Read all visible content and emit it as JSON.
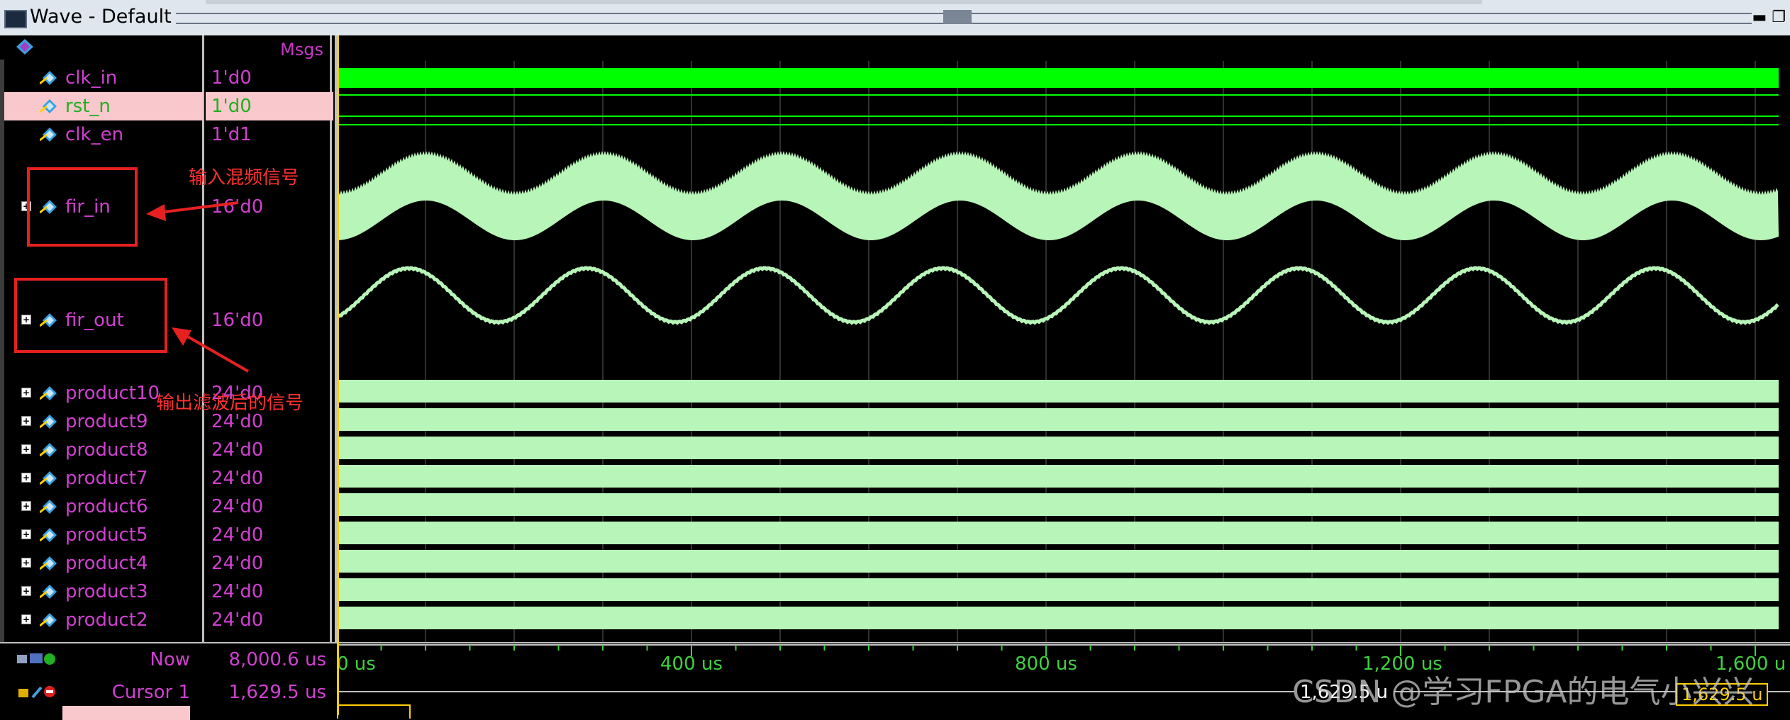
{
  "window": {
    "title": "Wave - Default"
  },
  "header": {
    "msgs_label": "Msgs"
  },
  "signals": [
    {
      "name": "clk_in",
      "value": "1'd0",
      "expandable": false,
      "selected": false
    },
    {
      "name": "rst_n",
      "value": "1'd0",
      "expandable": false,
      "selected": true
    },
    {
      "name": "clk_en",
      "value": "1'd1",
      "expandable": false,
      "selected": false
    },
    {
      "name": "fir_in",
      "value": "16'd0",
      "expandable": true,
      "selected": false
    },
    {
      "name": "fir_out",
      "value": "16'd0",
      "expandable": true,
      "selected": false
    },
    {
      "name": "product10",
      "value": "24'd0",
      "expandable": true,
      "selected": false
    },
    {
      "name": "product9",
      "value": "24'd0",
      "expandable": true,
      "selected": false
    },
    {
      "name": "product8",
      "value": "24'd0",
      "expandable": true,
      "selected": false
    },
    {
      "name": "product7",
      "value": "24'd0",
      "expandable": true,
      "selected": false
    },
    {
      "name": "product6",
      "value": "24'd0",
      "expandable": true,
      "selected": false
    },
    {
      "name": "product5",
      "value": "24'd0",
      "expandable": true,
      "selected": false
    },
    {
      "name": "product4",
      "value": "24'd0",
      "expandable": true,
      "selected": false
    },
    {
      "name": "product3",
      "value": "24'd0",
      "expandable": true,
      "selected": false
    },
    {
      "name": "product2",
      "value": "24'd0",
      "expandable": true,
      "selected": false
    }
  ],
  "bottom": {
    "now_label": "Now",
    "now_value": "8,000.6 us",
    "cursor1_label": "Cursor 1",
    "cursor1_value": "1,629.5 us"
  },
  "timeline": {
    "ticks": [
      "0 us",
      "400 us",
      "800 us",
      "1,200 us",
      "1,600 u"
    ],
    "cursor_readout": "1,629.5 u",
    "cursor_readout_right": "1,629.5 u"
  },
  "annotations": {
    "fir_in_note": "输入混频信号",
    "fir_out_note": "输出滤波后的信号"
  },
  "watermark": "CSDN @学习FPGA的电气小兴兴",
  "colors": {
    "wave_bright": "#00ff00",
    "wave_pale": "#b8f5b8",
    "signal_name": "#d040d0",
    "annotation": "#e62020",
    "cursor": "#ffd000"
  }
}
